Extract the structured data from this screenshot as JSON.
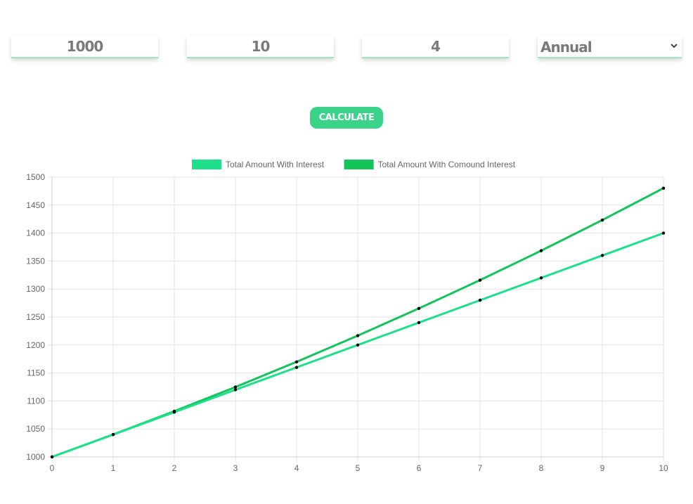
{
  "inputs": {
    "principal": "1000",
    "years": "10",
    "rate": "4",
    "frequency": "Annual"
  },
  "calculate_label": "CALCULATE",
  "colors": {
    "simple": "#1fe08a",
    "compound": "#12c45a",
    "button": "#3bd389",
    "input_text": "#7a7a7a",
    "point": "#000000",
    "grid": "#e3e3e3"
  },
  "chart_data": {
    "type": "line",
    "x": [
      0,
      1,
      2,
      3,
      4,
      5,
      6,
      7,
      8,
      9,
      10
    ],
    "series": [
      {
        "name": "Total Amount With Interest",
        "values": [
          1000,
          1040,
          1080,
          1120,
          1160,
          1200,
          1240,
          1280,
          1320,
          1360,
          1400
        ]
      },
      {
        "name": "Total Amount With Comound Interest",
        "values": [
          1000,
          1040,
          1081.6,
          1124.86,
          1169.86,
          1216.65,
          1265.32,
          1315.93,
          1368.57,
          1423.31,
          1480.24
        ]
      }
    ],
    "ylim": [
      1000,
      1500
    ],
    "ytick_step": 50,
    "grid": true,
    "legend": "top-center"
  }
}
